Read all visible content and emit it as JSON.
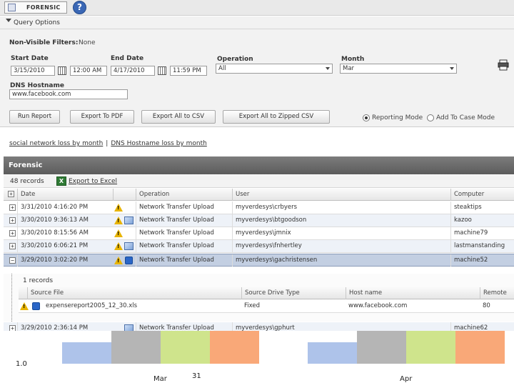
{
  "app": {
    "tab_label": "FORENSIC",
    "help_glyph": "?"
  },
  "query": {
    "section_title": "Query Options",
    "non_visible_label": "Non-Visible Filters:",
    "non_visible_value": "None",
    "start_date_label": "Start Date",
    "start_date": "3/15/2010",
    "start_time": "12:00 AM",
    "end_date_label": "End Date",
    "end_date": "4/17/2010",
    "end_time": "11:59 PM",
    "operation_label": "Operation",
    "operation_value": "All",
    "month_label": "Month",
    "month_value": "Mar",
    "dns_label": "DNS Hostname",
    "dns_value": "www.facebook.com",
    "buttons": {
      "run_report": "Run Report",
      "export_pdf": "Export To PDF",
      "export_csv": "Export All to CSV",
      "export_zip": "Export All to Zipped CSV"
    },
    "mode_reporting": "Reporting Mode",
    "mode_case": "Add To Case Mode",
    "selected_mode": "reporting"
  },
  "links": {
    "first": "social network loss by month",
    "separator": "|",
    "second": "DNS Hostname loss by month"
  },
  "forensic": {
    "title": "Forensic",
    "records": "48 records",
    "excel_glyph": "X",
    "export_excel": "Export to Excel",
    "columns": {
      "date": "Date",
      "operation": "Operation",
      "user": "User",
      "computer": "Computer"
    },
    "rows": [
      {
        "expander": "+",
        "date": "3/31/2010 4:16:20 PM",
        "operation": "Network Transfer Upload",
        "user": "myverdesys\\crbyers",
        "computer": "steaktips"
      },
      {
        "expander": "+",
        "date": "3/30/2010 9:36:13 AM",
        "operation": "Network Transfer Upload",
        "user": "myverdesys\\btgoodson",
        "computer": "kazoo"
      },
      {
        "expander": "+",
        "date": "3/30/2010 8:15:56 AM",
        "operation": "Network Transfer Upload",
        "user": "myverdesys\\jmnix",
        "computer": "machine79"
      },
      {
        "expander": "+",
        "date": "3/30/2010 6:06:21 PM",
        "operation": "Network Transfer Upload",
        "user": "myverdesys\\fnhertley",
        "computer": "lastmanstanding"
      },
      {
        "expander": "−",
        "date": "3/29/2010 3:02:20 PM",
        "operation": "Network Transfer Upload",
        "user": "myverdesys\\gachristensen",
        "computer": "machine52"
      }
    ],
    "detail": {
      "count": "1 records",
      "columns": {
        "source_file": "Source File",
        "source_drive_type": "Source Drive Type",
        "host_name": "Host name",
        "remote": "Remote"
      },
      "row": {
        "source_file": "expensereport2005_12_30.xls",
        "source_drive_type": "Fixed",
        "host_name": "www.facebook.com",
        "remote": "80"
      }
    },
    "partial_row": {
      "expander": "+",
      "date": "3/29/2010 2:36:14 PM",
      "operation": "Network Transfer Upload",
      "user": "myverdesys\\gphurt",
      "computer": "machine62"
    }
  },
  "chart_data": {
    "type": "bar",
    "categories": [
      "Mar",
      "Apr"
    ],
    "annotation": "31",
    "y_tick_label": "1.0",
    "series": [
      {
        "values": [
          1.0,
          1.0
        ],
        "color": "#aec3ea"
      },
      {
        "values": [
          1.0,
          1.0
        ],
        "color": "#b5b5b5"
      },
      {
        "values": [
          1.0,
          1.0
        ],
        "color": "#cfe48c"
      },
      {
        "values": [
          1.0,
          1.0
        ],
        "color": "#f9a878"
      }
    ],
    "ylim": [
      0,
      1.6
    ]
  }
}
